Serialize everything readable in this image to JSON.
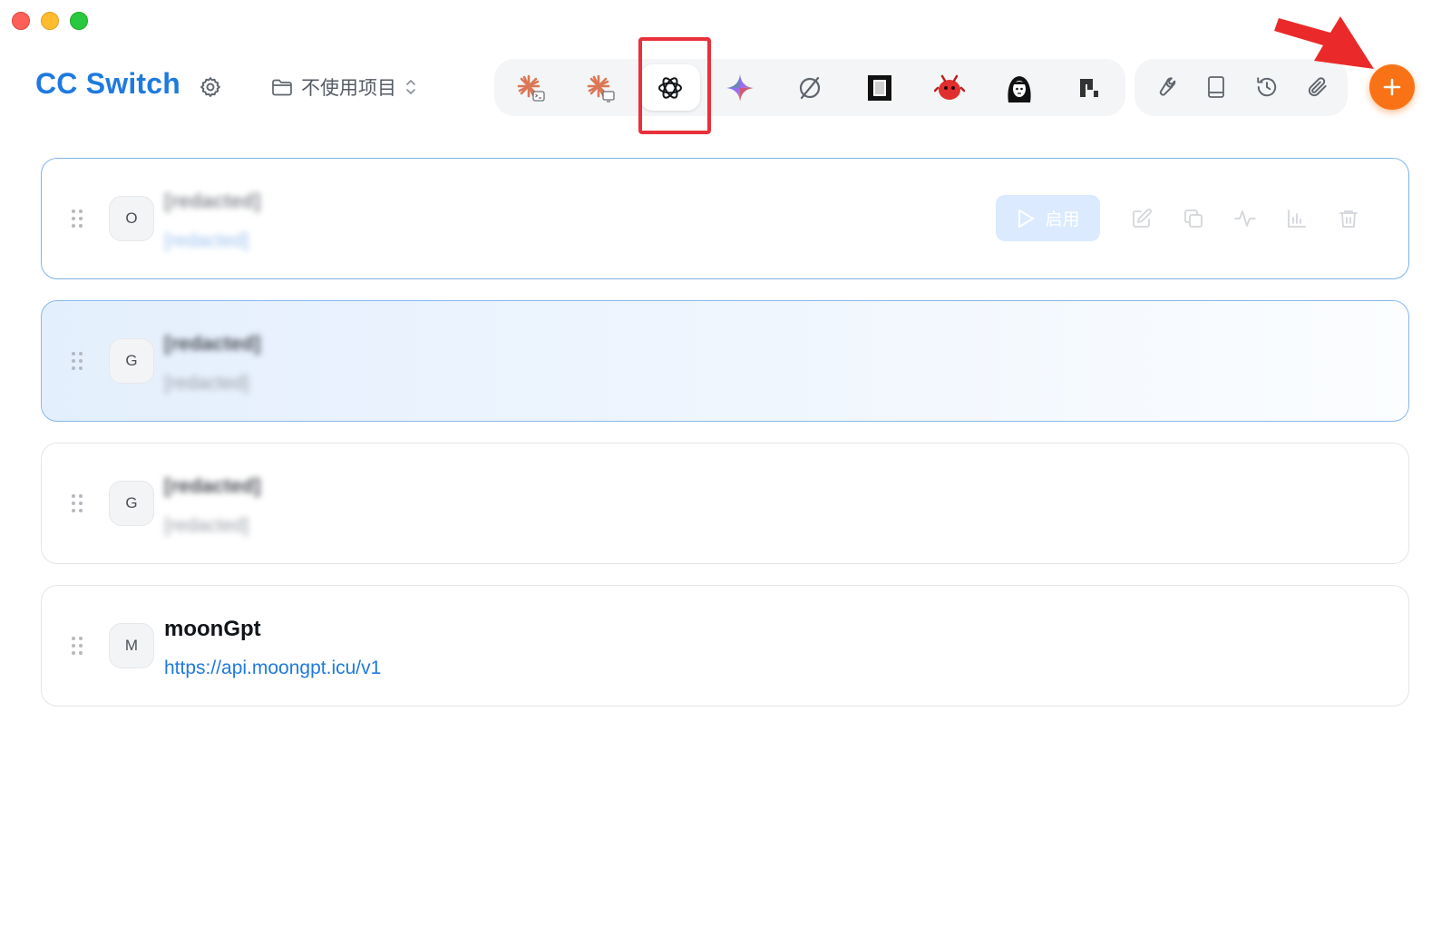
{
  "window": {
    "title": "CC Switch"
  },
  "header": {
    "settings_icon": "gear-icon",
    "project_selector": {
      "label": "不使用项目",
      "icon": "folder-icon",
      "chevron": "chevron-updown-icon"
    }
  },
  "app_tabs": [
    {
      "name": "claude-code",
      "icon": "claude-terminal-icon",
      "active": false
    },
    {
      "name": "claude-desktop",
      "icon": "claude-desktop-icon",
      "active": false
    },
    {
      "name": "codex",
      "icon": "openai-icon",
      "active": true
    },
    {
      "name": "gemini",
      "icon": "gemini-icon",
      "active": false
    },
    {
      "name": "opencode",
      "icon": "slash-circle-icon",
      "active": false
    },
    {
      "name": "terminal-app",
      "icon": "black-square-icon",
      "active": false
    },
    {
      "name": "red-agent",
      "icon": "red-bird-icon",
      "active": false
    },
    {
      "name": "character-app",
      "icon": "character-icon",
      "active": false
    },
    {
      "name": "pixel-app",
      "icon": "pixel-blocks-icon",
      "active": false
    }
  ],
  "toolbar": {
    "tools": [
      "wrench-icon",
      "book-icon",
      "history-icon",
      "paperclip-icon"
    ],
    "add_icon": "plus-icon"
  },
  "providers": [
    {
      "initial": "O",
      "name": "[redacted]",
      "url": "[redacted]",
      "state": "selected",
      "enable_label": "启用"
    },
    {
      "initial": "G",
      "name": "[redacted]",
      "url": "[redacted]",
      "state": "current"
    },
    {
      "initial": "G",
      "name": "[redacted]",
      "url": "[redacted]",
      "state": "normal"
    },
    {
      "initial": "M",
      "name": "moonGpt",
      "url": "https://api.moongpt.icu/v1",
      "state": "normal"
    }
  ],
  "colors": {
    "accent": "#1f7ae0",
    "add_button": "#f97316",
    "highlight": "#e8313a"
  }
}
